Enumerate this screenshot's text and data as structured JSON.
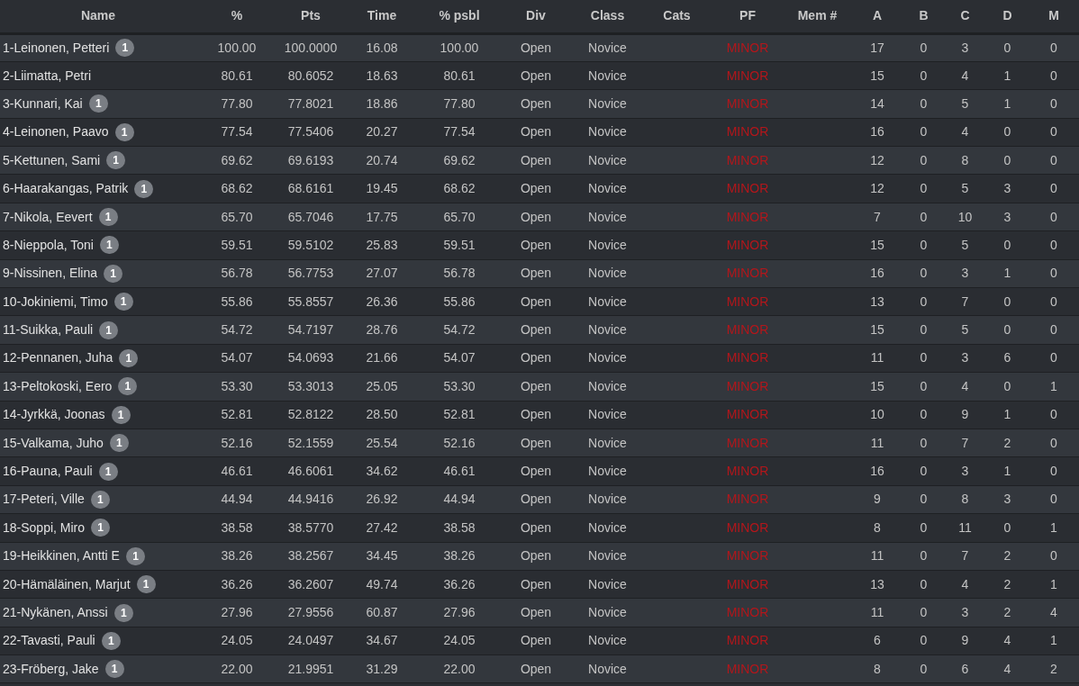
{
  "table": {
    "columns": [
      "Name",
      "%",
      "Pts",
      "Time",
      "% psbl",
      "Div",
      "Class",
      "Cats",
      "PF",
      "Mem #",
      "A",
      "B",
      "C",
      "D",
      "M"
    ],
    "rows": [
      {
        "badge": "1",
        "cells": [
          "1-Leinonen, Petteri",
          "100.00",
          "100.0000",
          "16.08",
          "100.00",
          "Open",
          "Novice",
          null,
          "MINOR",
          null,
          "17",
          "0",
          "3",
          "0",
          "0"
        ]
      },
      {
        "cells": [
          "2-Liimatta, Petri",
          "80.61",
          "80.6052",
          "18.63",
          "80.61",
          "Open",
          "Novice",
          null,
          "MINOR",
          null,
          "15",
          "0",
          "4",
          "1",
          "0"
        ]
      },
      {
        "badge": "1",
        "cells": [
          "3-Kunnari, Kai",
          "77.80",
          "77.8021",
          "18.86",
          "77.80",
          "Open",
          "Novice",
          null,
          "MINOR",
          null,
          "14",
          "0",
          "5",
          "1",
          "0"
        ]
      },
      {
        "badge": "1",
        "cells": [
          "4-Leinonen, Paavo",
          "77.54",
          "77.5406",
          "20.27",
          "77.54",
          "Open",
          "Novice",
          null,
          "MINOR",
          null,
          "16",
          "0",
          "4",
          "0",
          "0"
        ]
      },
      {
        "badge": "1",
        "cells": [
          "5-Kettunen, Sami",
          "69.62",
          "69.6193",
          "20.74",
          "69.62",
          "Open",
          "Novice",
          null,
          "MINOR",
          null,
          "12",
          "0",
          "8",
          "0",
          "0"
        ]
      },
      {
        "badge": "1",
        "cells": [
          "6-Haarakangas, Patrik",
          "68.62",
          "68.6161",
          "19.45",
          "68.62",
          "Open",
          "Novice",
          null,
          "MINOR",
          null,
          "12",
          "0",
          "5",
          "3",
          "0"
        ]
      },
      {
        "badge": "1",
        "cells": [
          "7-Nikola, Eevert",
          "65.70",
          "65.7046",
          "17.75",
          "65.70",
          "Open",
          "Novice",
          null,
          "MINOR",
          null,
          "7",
          "0",
          "10",
          "3",
          "0"
        ]
      },
      {
        "badge": "1",
        "cells": [
          "8-Nieppola, Toni",
          "59.51",
          "59.5102",
          "25.83",
          "59.51",
          "Open",
          "Novice",
          null,
          "MINOR",
          null,
          "15",
          "0",
          "5",
          "0",
          "0"
        ]
      },
      {
        "badge": "1",
        "cells": [
          "9-Nissinen, Elina",
          "56.78",
          "56.7753",
          "27.07",
          "56.78",
          "Open",
          "Novice",
          null,
          "MINOR",
          null,
          "16",
          "0",
          "3",
          "1",
          "0"
        ]
      },
      {
        "badge": "1",
        "cells": [
          "10-Jokiniemi, Timo",
          "55.86",
          "55.8557",
          "26.36",
          "55.86",
          "Open",
          "Novice",
          null,
          "MINOR",
          null,
          "13",
          "0",
          "7",
          "0",
          "0"
        ]
      },
      {
        "badge": "1",
        "cells": [
          "11-Suikka, Pauli",
          "54.72",
          "54.7197",
          "28.76",
          "54.72",
          "Open",
          "Novice",
          null,
          "MINOR",
          null,
          "15",
          "0",
          "5",
          "0",
          "0"
        ]
      },
      {
        "badge": "1",
        "cells": [
          "12-Pennanen, Juha",
          "54.07",
          "54.0693",
          "21.66",
          "54.07",
          "Open",
          "Novice",
          null,
          "MINOR",
          null,
          "11",
          "0",
          "3",
          "6",
          "0"
        ]
      },
      {
        "badge": "1",
        "cells": [
          "13-Peltokoski, Eero",
          "53.30",
          "53.3013",
          "25.05",
          "53.30",
          "Open",
          "Novice",
          null,
          "MINOR",
          null,
          "15",
          "0",
          "4",
          "0",
          "1"
        ]
      },
      {
        "badge": "1",
        "cells": [
          "14-Jyrkkä, Joonas",
          "52.81",
          "52.8122",
          "28.50",
          "52.81",
          "Open",
          "Novice",
          null,
          "MINOR",
          null,
          "10",
          "0",
          "9",
          "1",
          "0"
        ]
      },
      {
        "badge": "1",
        "cells": [
          "15-Valkama, Juho",
          "52.16",
          "52.1559",
          "25.54",
          "52.16",
          "Open",
          "Novice",
          null,
          "MINOR",
          null,
          "11",
          "0",
          "7",
          "2",
          "0"
        ]
      },
      {
        "badge": "1",
        "cells": [
          "16-Pauna, Pauli",
          "46.61",
          "46.6061",
          "34.62",
          "46.61",
          "Open",
          "Novice",
          null,
          "MINOR",
          null,
          "16",
          "0",
          "3",
          "1",
          "0"
        ]
      },
      {
        "badge": "1",
        "cells": [
          "17-Peteri, Ville",
          "44.94",
          "44.9416",
          "26.92",
          "44.94",
          "Open",
          "Novice",
          null,
          "MINOR",
          null,
          "9",
          "0",
          "8",
          "3",
          "0"
        ]
      },
      {
        "badge": "1",
        "cells": [
          "18-Soppi, Miro",
          "38.58",
          "38.5770",
          "27.42",
          "38.58",
          "Open",
          "Novice",
          null,
          "MINOR",
          null,
          "8",
          "0",
          "11",
          "0",
          "1"
        ]
      },
      {
        "badge": "1",
        "cells": [
          "19-Heikkinen, Antti E",
          "38.26",
          "38.2567",
          "34.45",
          "38.26",
          "Open",
          "Novice",
          null,
          "MINOR",
          null,
          "11",
          "0",
          "7",
          "2",
          "0"
        ]
      },
      {
        "badge": "1",
        "cells": [
          "20-Hämäläinen, Marjut",
          "36.26",
          "36.2607",
          "49.74",
          "36.26",
          "Open",
          "Novice",
          null,
          "MINOR",
          null,
          "13",
          "0",
          "4",
          "2",
          "1"
        ]
      },
      {
        "badge": "1",
        "cells": [
          "21-Nykänen, Anssi",
          "27.96",
          "27.9556",
          "60.87",
          "27.96",
          "Open",
          "Novice",
          null,
          "MINOR",
          null,
          "11",
          "0",
          "3",
          "2",
          "4"
        ]
      },
      {
        "badge": "1",
        "cells": [
          "22-Tavasti, Pauli",
          "24.05",
          "24.0497",
          "34.67",
          "24.05",
          "Open",
          "Novice",
          null,
          "MINOR",
          null,
          "6",
          "0",
          "9",
          "4",
          "1"
        ]
      },
      {
        "badge": "1",
        "cells": [
          "23-Fröberg, Jake",
          "22.00",
          "21.9951",
          "31.29",
          "22.00",
          "Open",
          "Novice",
          null,
          "MINOR",
          null,
          "8",
          "0",
          "6",
          "4",
          "2"
        ]
      }
    ]
  }
}
